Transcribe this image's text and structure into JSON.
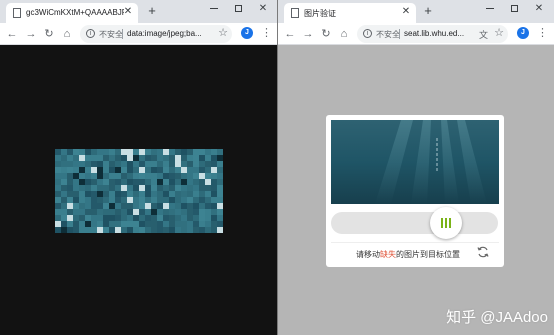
{
  "left_window": {
    "tab_title": "gc3WiCmKXtM+QAAAABJRU5",
    "insecure_label": "不安全",
    "url": "data:image/jpeg;ba...",
    "profile_initial": "J"
  },
  "right_window": {
    "tab_title": "图片验证",
    "insecure_label": "不安全",
    "url": "seat.lib.whu.ed...",
    "profile_initial": "J",
    "captcha": {
      "instruction_prefix": "请移动",
      "instruction_highlight": "缺失",
      "instruction_suffix": "的图片到目标位置"
    }
  },
  "colors": {
    "left_background": "#121212",
    "right_background": "#b5b5b5",
    "tile_base": "#2e6b7a",
    "slider_grip": "#7ab317",
    "highlight": "#e0553a",
    "profile": "#1a73e8"
  },
  "icons": [
    "document-icon",
    "close-icon",
    "plus-icon",
    "minimize-icon",
    "maximize-icon",
    "back-icon",
    "forward-icon",
    "reload-icon",
    "home-icon",
    "info-icon",
    "star-icon",
    "kebab-menu-icon",
    "translate-icon",
    "refresh-icon"
  ],
  "watermark": "知乎 @JAAdoo"
}
